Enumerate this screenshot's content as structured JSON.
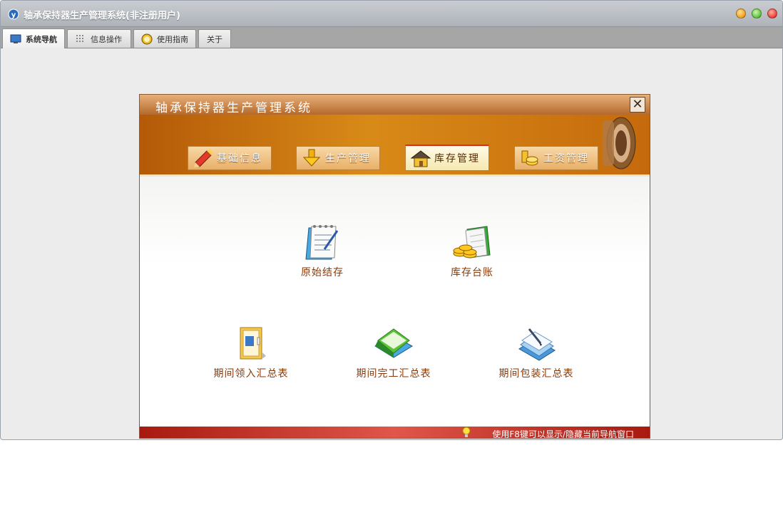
{
  "window": {
    "title": "轴承保持器生产管理系统(非注册用户)"
  },
  "tabs": [
    {
      "label": "系统导航",
      "icon": "monitor-icon",
      "active": true
    },
    {
      "label": "信息操作",
      "icon": "grid-icon",
      "active": false
    },
    {
      "label": "使用指南",
      "icon": "help-circle-icon",
      "active": false
    },
    {
      "label": "关于",
      "icon": "",
      "active": false
    }
  ],
  "dialog": {
    "title": "轴承保持器生产管理系统",
    "categories": [
      {
        "label": "基础信息",
        "icon": "pencil-icon",
        "active": false
      },
      {
        "label": "生产管理",
        "icon": "download-arrow-icon",
        "active": false
      },
      {
        "label": "库存管理",
        "icon": "house-icon",
        "active": true
      },
      {
        "label": "工资管理",
        "icon": "coins-icon",
        "active": false
      }
    ],
    "functions": [
      {
        "label": "原始结存",
        "icon": "notepad-icon"
      },
      {
        "label": "库存台账",
        "icon": "ledger-coins-icon"
      },
      {
        "label": "期间领入汇总表",
        "icon": "document-icon"
      },
      {
        "label": "期间完工汇总表",
        "icon": "folder-icon"
      },
      {
        "label": "期间包装汇总表",
        "icon": "documents-pen-icon"
      }
    ],
    "footer_hint": "使用F8键可以显示/隐藏当前导航窗口"
  },
  "colors": {
    "banner": "#c56a0c",
    "function_label": "#8a3a08",
    "footer": "#c0302a"
  }
}
